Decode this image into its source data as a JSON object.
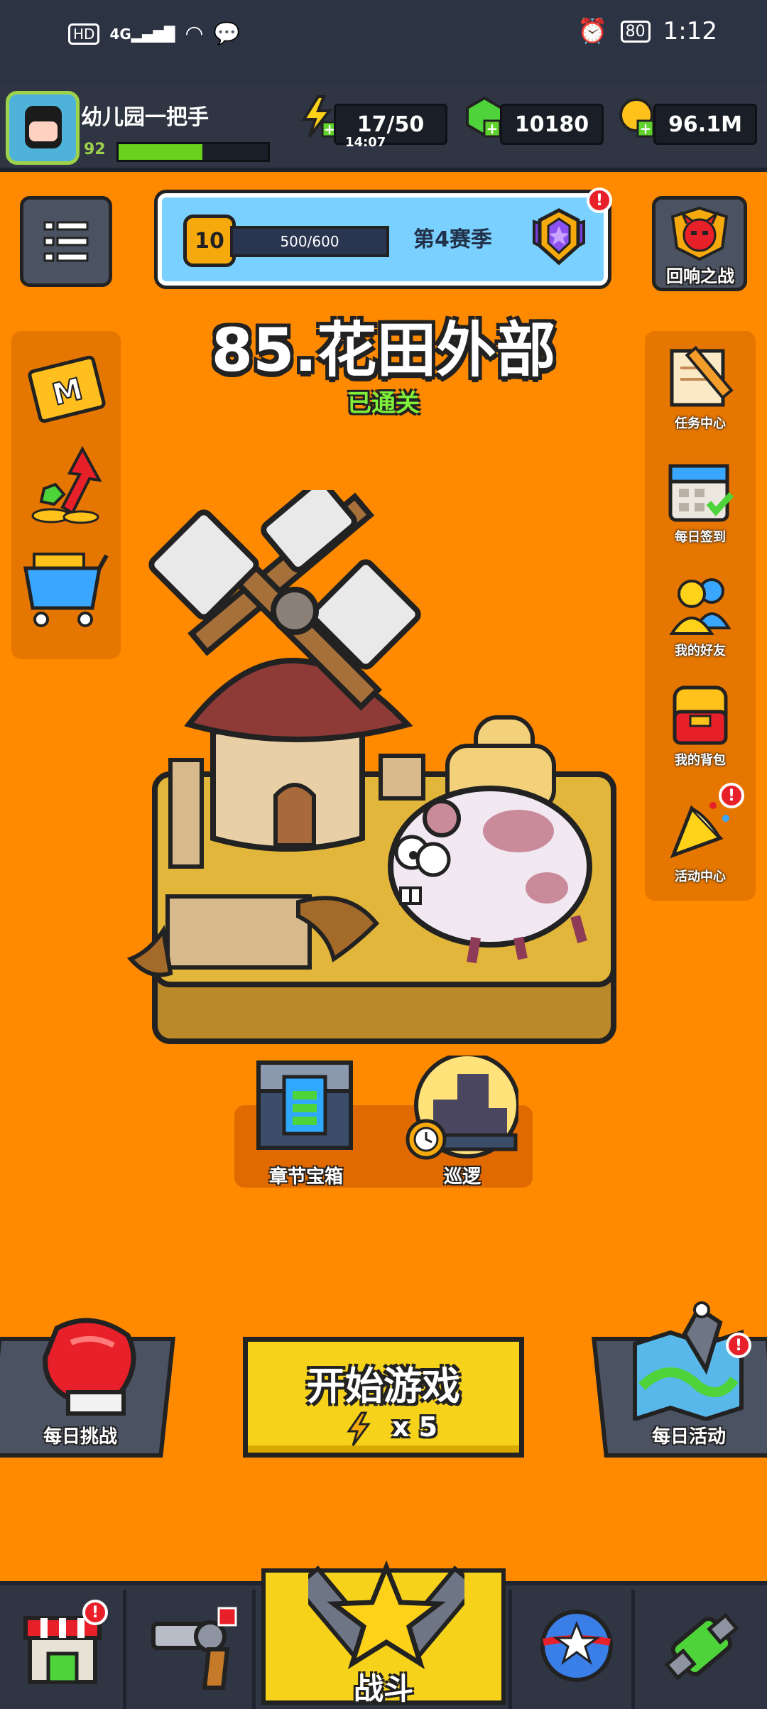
{
  "status_bar": {
    "network": "HD",
    "signal": "4G",
    "battery": "80",
    "time": "1:12"
  },
  "player": {
    "name": "幼儿园一把手",
    "level": "92",
    "xp_fraction": 0.56
  },
  "resources": {
    "energy": "17/50",
    "energy_timer": "14:07",
    "gems": "10180",
    "coins": "96.1M"
  },
  "season": {
    "level": "10",
    "progress": "500/600",
    "progress_fraction": 0.833,
    "label": "第4赛季",
    "alert": "!"
  },
  "echo_battle": {
    "label": "回响之战"
  },
  "stage": {
    "title": "85.花田外部",
    "status": "已通关"
  },
  "right_menu": [
    {
      "label": "任务中心",
      "icon": "scroll-pencil-icon"
    },
    {
      "label": "每日签到",
      "icon": "calendar-check-icon"
    },
    {
      "label": "我的好友",
      "icon": "friends-icon"
    },
    {
      "label": "我的背包",
      "icon": "backpack-icon"
    },
    {
      "label": "活动中心",
      "icon": "party-popper-icon",
      "alert": "!"
    }
  ],
  "chest": {
    "label": "章节宝箱"
  },
  "patrol": {
    "label": "巡逻"
  },
  "daily_challenge": {
    "label": "每日挑战"
  },
  "start_game": {
    "label": "开始游戏",
    "cost": "x 5"
  },
  "daily_event": {
    "label": "每日活动",
    "alert": "!"
  },
  "nav": {
    "battle": "战斗",
    "shop_alert": "!"
  },
  "colors": {
    "background": "#ff8a00",
    "accent_yellow": "#f7d21b",
    "panel": "#2f3542",
    "alert_red": "#e8202a"
  }
}
